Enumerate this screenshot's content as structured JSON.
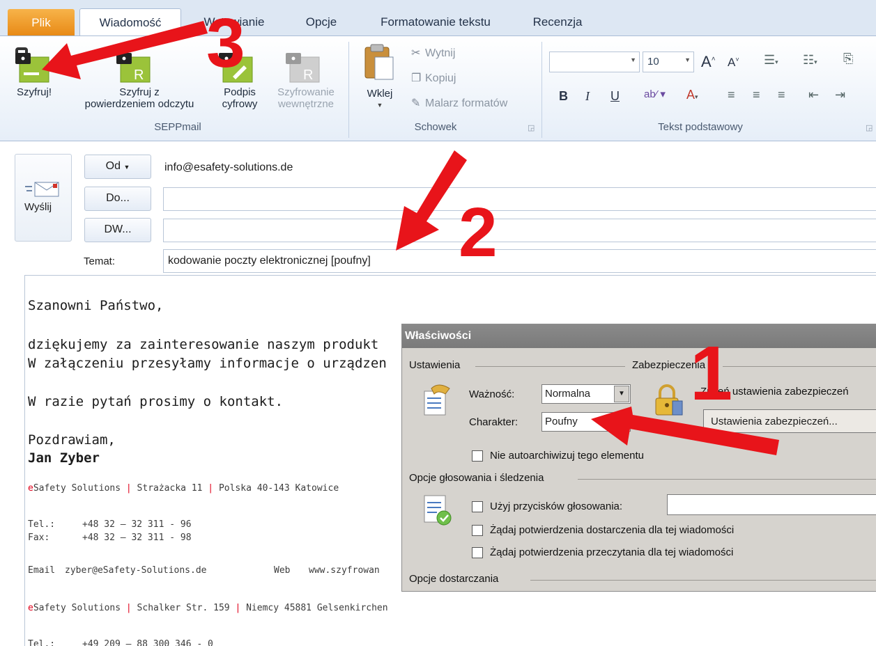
{
  "ribbon": {
    "tabs": [
      "Plik",
      "Wiadomość",
      "Wstawianie",
      "Opcje",
      "Formatowanie tekstu",
      "Recenzja"
    ],
    "active_tab": "Wiadomość",
    "sepp": {
      "group_label": "SEPPmail",
      "encrypt": "Szyfruj!",
      "encrypt_receipt_line1": "Szyfruj z",
      "encrypt_receipt_line2": "powierdzeniem odczytu",
      "sign_line1": "Podpis",
      "sign_line2": "cyfrowy",
      "internal_line1": "Szyfrowanie",
      "internal_line2": "wewnętrzne"
    },
    "clipboard": {
      "group_label": "Schowek",
      "paste": "Wklej",
      "cut": "Wytnij",
      "copy": "Kopiuj",
      "format_painter": "Malarz formatów"
    },
    "basic_text": {
      "group_label": "Tekst podstawowy",
      "font_size": "10",
      "bold": "B",
      "italic": "I",
      "underline": "U"
    }
  },
  "compose": {
    "send": "Wyślij",
    "from_button": "Od",
    "from_value": "info@esafety-solutions.de",
    "to_button": "Do...",
    "to_value": "",
    "cc_button": "DW...",
    "cc_value": "",
    "subject_label": "Temat:",
    "subject_value": "kodowanie poczty elektronicznej [poufny]"
  },
  "body": {
    "greeting": "Szanowni Państwo,",
    "line1": "dziękujemy za zainteresowanie naszym produkt",
    "line2": "W załączeniu przesyłamy informacje o urządzen",
    "line3": "W razie pytań prosimy o kontakt.",
    "closing": "Pozdrawiam,",
    "name": "Jan Zyber",
    "sig": {
      "brand_e": "e",
      "brand_rest": "Safety Solutions",
      "sep": "|",
      "addr1_street": "Strażacka 11",
      "addr1_city": "Polska 40-143 Katowice",
      "tel_label": "Tel.:",
      "tel1": "+48 32 – 32 311 - 96",
      "fax_label": "Fax:",
      "fax1": "+48 32 – 32 311 - 98",
      "email_label": "Email",
      "email_value": "zyber@eSafety-Solutions.de",
      "web_label": "Web",
      "web_value": "www.szyfrowan",
      "addr2_street": "Schalker Str. 159",
      "addr2_city": "Niemcy 45881 Gelsenkirchen",
      "tel2": "+49 209 – 88 300 346 - 0"
    }
  },
  "dialog": {
    "title": "Właściwości",
    "settings_section": "Ustawienia",
    "security_section": "Zabezpieczenia",
    "importance_label": "Ważność:",
    "importance_value": "Normalna",
    "sensitivity_label": "Charakter:",
    "sensitivity_value": "Poufny",
    "change_security": "Zmień ustawienia zabezpieczeń",
    "security_settings_button": "Ustawienia zabezpieczeń...",
    "no_autoarchive": "Nie autoarchiwizuj tego elementu",
    "voting_section": "Opcje głosowania i śledzenia",
    "use_voting": "Użyj przycisków głosowania:",
    "delivery_receipt": "Żądaj potwierdzenia dostarczenia dla tej wiadomości",
    "read_receipt": "Żądaj potwierdzenia przeczytania dla tej wiadomości",
    "delivery_section": "Opcje dostarczania"
  },
  "annotations": {
    "n1": "1",
    "n2": "2",
    "n3": "3",
    "arrow_color": "#e8141a"
  }
}
